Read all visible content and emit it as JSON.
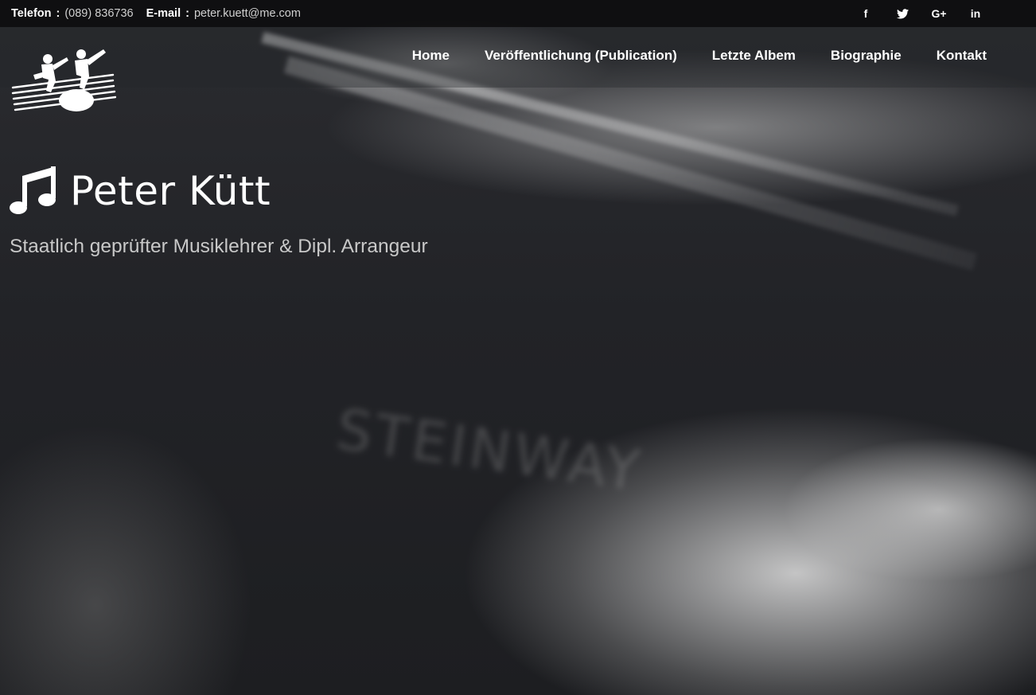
{
  "contact": {
    "phone_label": "Telefon",
    "phone_value": "(089) 836736",
    "email_label": "E-mail",
    "email_value": "peter.kuett@me.com"
  },
  "social": {
    "facebook": "f",
    "twitter": "twitter-icon",
    "googleplus": "G+",
    "linkedin": "in"
  },
  "nav": {
    "items": [
      "Home",
      "Veröffentlichung (Publication)",
      "Letzte Albem",
      "Biographie",
      "Kontakt"
    ]
  },
  "hero": {
    "title": "Peter Kütt",
    "subtitle": "Staatlich geprüfter Musiklehrer & Dipl. Arrangeur",
    "icon": "music-note-icon"
  }
}
